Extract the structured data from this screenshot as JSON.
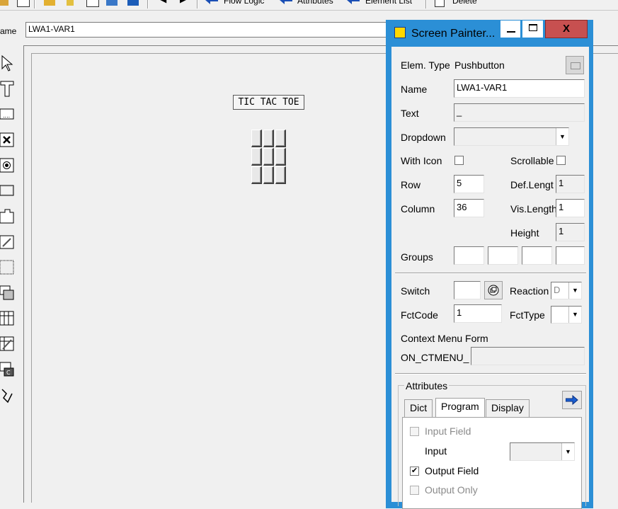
{
  "toolbar": {
    "flow_logic": "Flow Logic",
    "attributes": "Attributes",
    "element_list": "Element List",
    "delete": "Delete"
  },
  "name_row": {
    "label": "ame",
    "value": "LWA1-VAR1"
  },
  "canvas": {
    "title": "TIC TAC TOE"
  },
  "dialog": {
    "title": "Screen Painter...",
    "close_glyph": "X",
    "elem_type_label": "Elem. Type",
    "elem_type_value": "Pushbutton",
    "name_label": "Name",
    "name_value": "LWA1-VAR1",
    "text_label": "Text",
    "text_value": "_",
    "dropdown_label": "Dropdown",
    "with_icon_label": "With Icon",
    "scrollable_label": "Scrollable",
    "row_label": "Row",
    "row_value": "5",
    "def_length_label": "Def.Lengt",
    "def_length_value": "1",
    "column_label": "Column",
    "column_value": "36",
    "vis_length_label": "Vis.Length",
    "vis_length_value": "1",
    "height_label": "Height",
    "height_value": "1",
    "groups_label": "Groups",
    "switch_label": "Switch",
    "reaction_label": "Reaction",
    "reaction_value": "D",
    "fctcode_label": "FctCode",
    "fctcode_value": "1",
    "fcttype_label": "FctType",
    "context_menu_label": "Context Menu Form",
    "on_ctmenu_label": "ON_CTMENU_",
    "attributes_group": "Attributes",
    "tabs": [
      "Dict",
      "Program",
      "Display"
    ],
    "input_field_label": "Input Field",
    "input_label": "Input",
    "output_field_label": "Output Field",
    "output_only_label": "Output Only",
    "output_field_checked": true
  }
}
